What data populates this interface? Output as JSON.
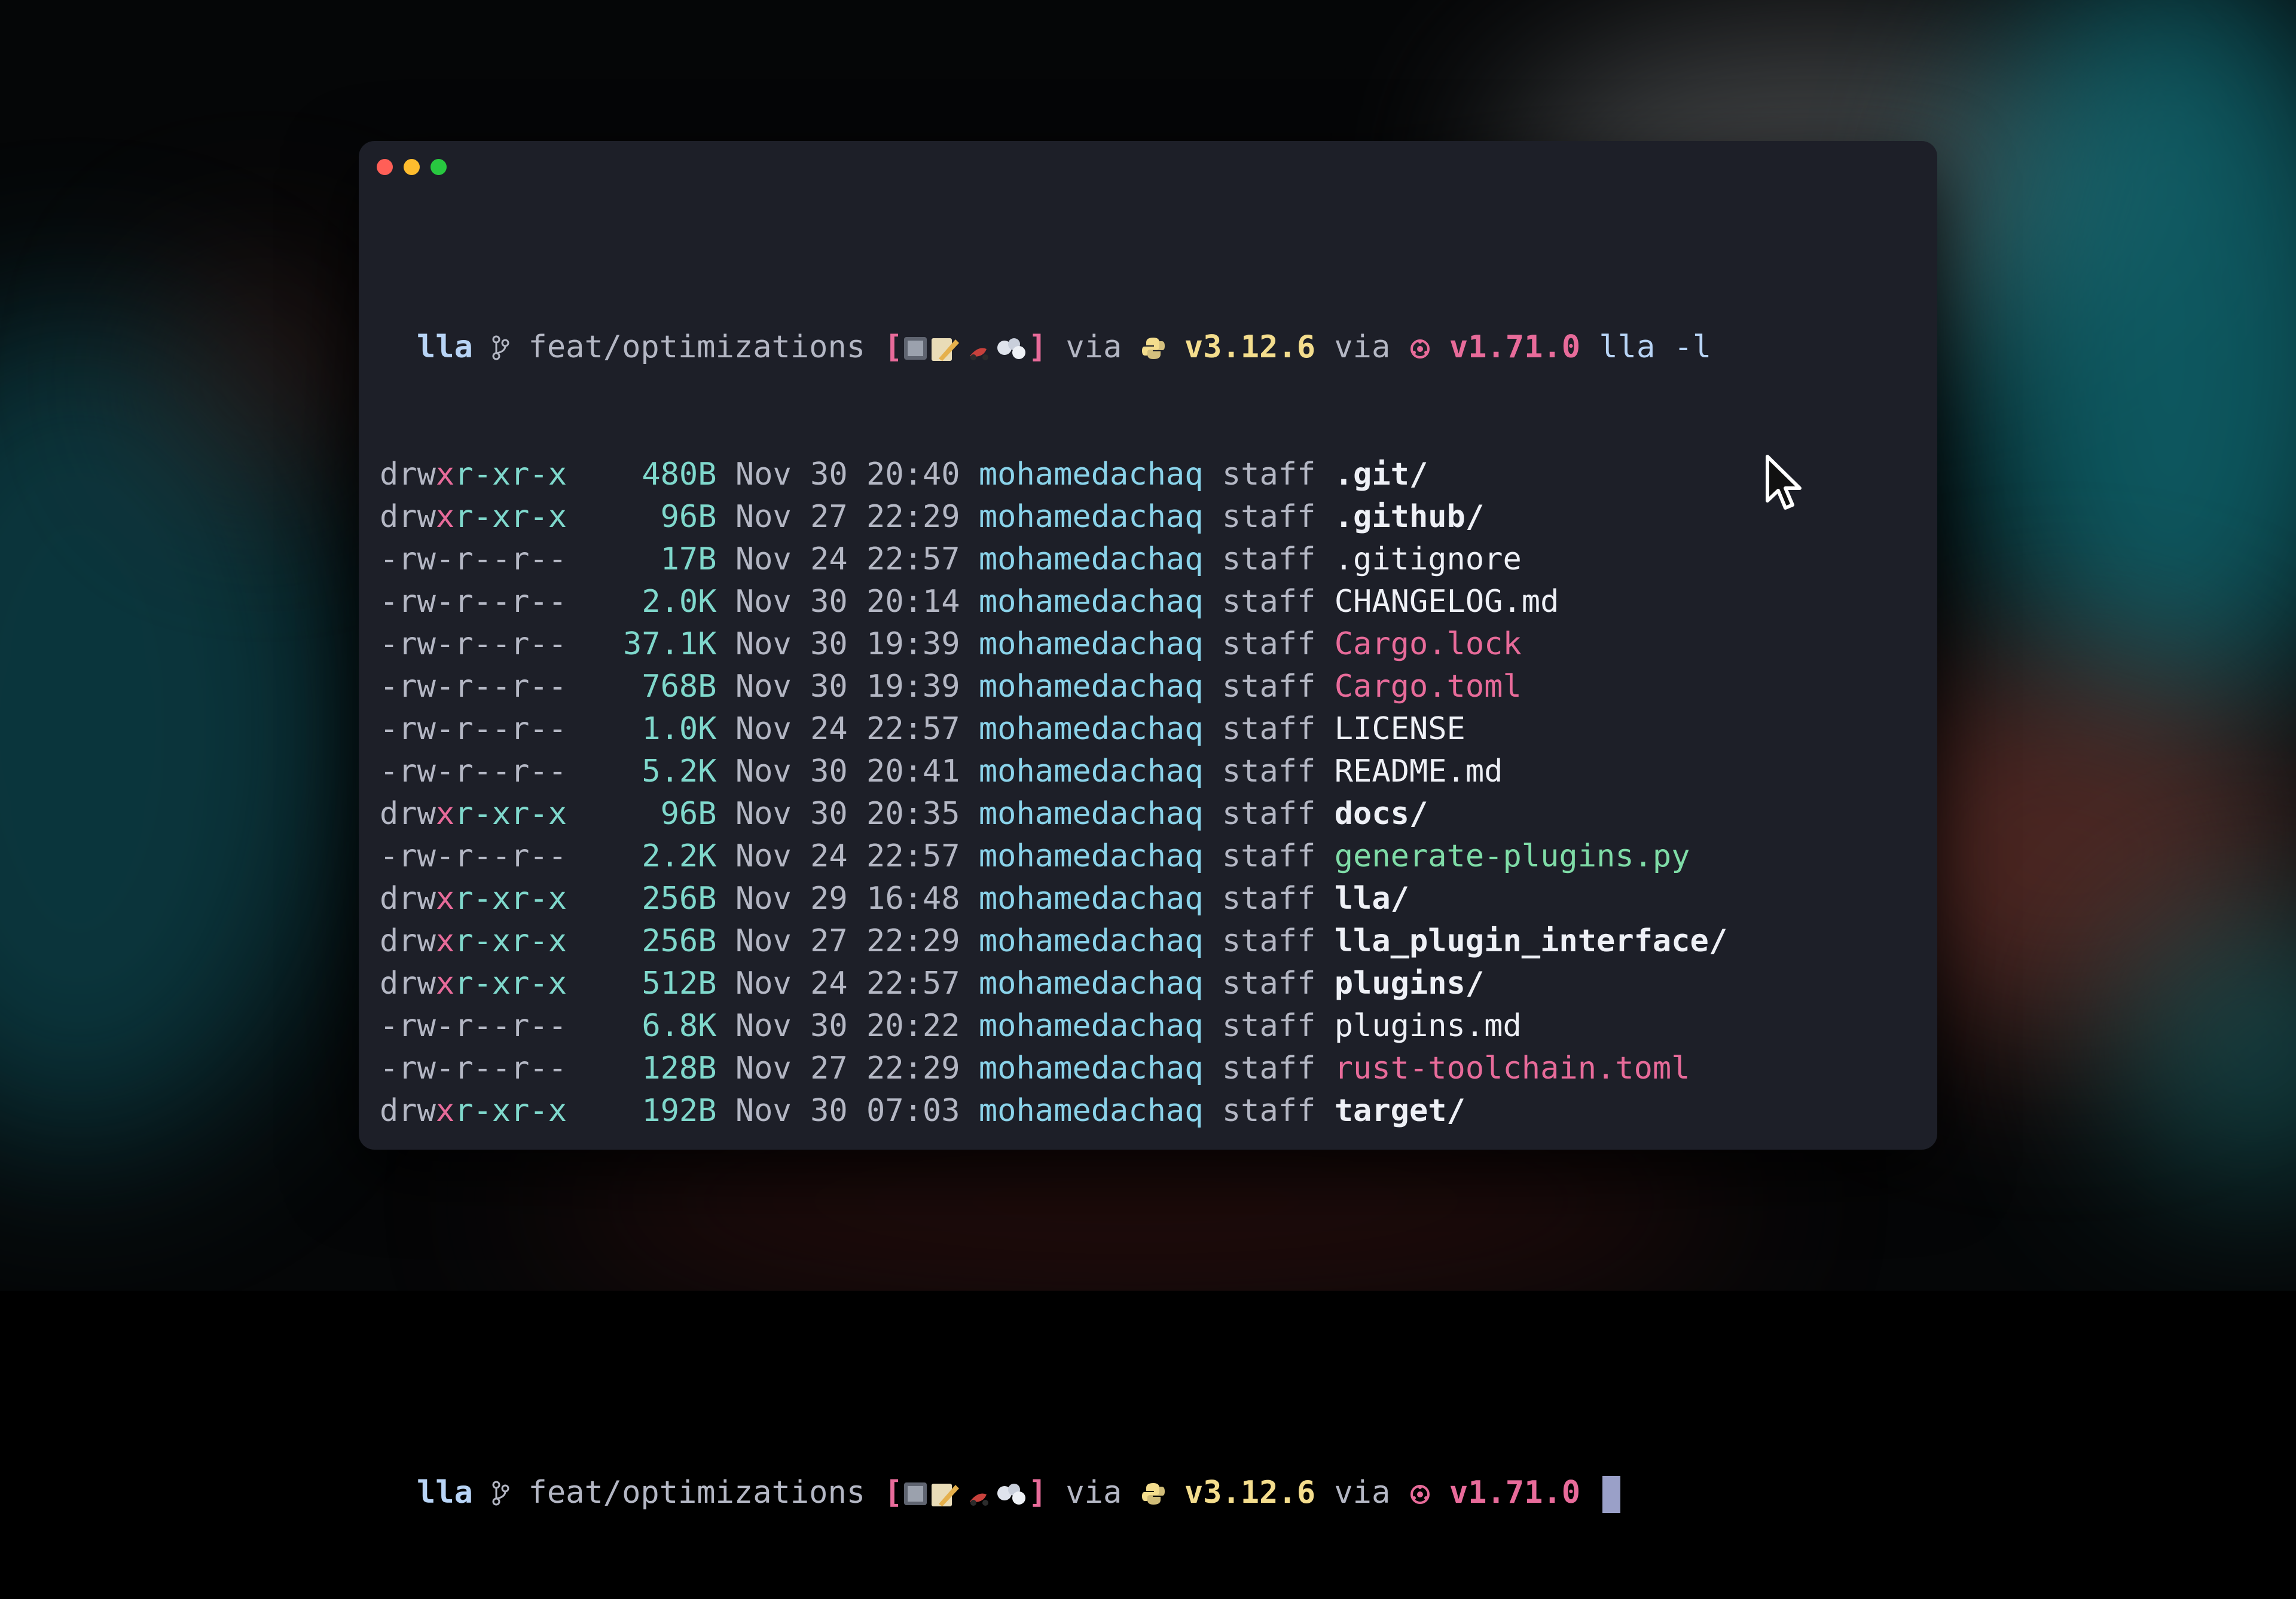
{
  "prompt": {
    "dir": "lla",
    "branch_icon": "git-branch-icon",
    "branch": "feat/optimizations",
    "status_open": "[",
    "status_close": "]",
    "via1": "via",
    "python_icon": "python-icon",
    "python_version": "v3.12.6",
    "via2": "via",
    "rust_icon": "rust-icon",
    "rust_version": "v1.71.0"
  },
  "command": "lla -l",
  "listing": [
    {
      "perm_pre": "drw",
      "perm_x": "x",
      "perm_rest": "r-xr-x",
      "size": "480B",
      "date": "Nov 30 20:40",
      "user": "mohamedachaq",
      "group": "staff",
      "name": ".git/",
      "kind": "dir"
    },
    {
      "perm_pre": "drw",
      "perm_x": "x",
      "perm_rest": "r-xr-x",
      "size": "96B",
      "date": "Nov 27 22:29",
      "user": "mohamedachaq",
      "group": "staff",
      "name": ".github/",
      "kind": "dir"
    },
    {
      "perm_pre": "-rw",
      "perm_x": "-",
      "perm_rest": "r--r--",
      "size": "17B",
      "date": "Nov 24 22:57",
      "user": "mohamedachaq",
      "group": "staff",
      "name": ".gitignore",
      "kind": "file"
    },
    {
      "perm_pre": "-rw",
      "perm_x": "-",
      "perm_rest": "r--r--",
      "size": "2.0K",
      "date": "Nov 30 20:14",
      "user": "mohamedachaq",
      "group": "staff",
      "name": "CHANGELOG.md",
      "kind": "file"
    },
    {
      "perm_pre": "-rw",
      "perm_x": "-",
      "perm_rest": "r--r--",
      "size": "37.1K",
      "date": "Nov 30 19:39",
      "user": "mohamedachaq",
      "group": "staff",
      "name": "Cargo.lock",
      "kind": "config"
    },
    {
      "perm_pre": "-rw",
      "perm_x": "-",
      "perm_rest": "r--r--",
      "size": "768B",
      "date": "Nov 30 19:39",
      "user": "mohamedachaq",
      "group": "staff",
      "name": "Cargo.toml",
      "kind": "config"
    },
    {
      "perm_pre": "-rw",
      "perm_x": "-",
      "perm_rest": "r--r--",
      "size": "1.0K",
      "date": "Nov 24 22:57",
      "user": "mohamedachaq",
      "group": "staff",
      "name": "LICENSE",
      "kind": "file"
    },
    {
      "perm_pre": "-rw",
      "perm_x": "-",
      "perm_rest": "r--r--",
      "size": "5.2K",
      "date": "Nov 30 20:41",
      "user": "mohamedachaq",
      "group": "staff",
      "name": "README.md",
      "kind": "file"
    },
    {
      "perm_pre": "drw",
      "perm_x": "x",
      "perm_rest": "r-xr-x",
      "size": "96B",
      "date": "Nov 30 20:35",
      "user": "mohamedachaq",
      "group": "staff",
      "name": "docs/",
      "kind": "dir"
    },
    {
      "perm_pre": "-rw",
      "perm_x": "-",
      "perm_rest": "r--r--",
      "size": "2.2K",
      "date": "Nov 24 22:57",
      "user": "mohamedachaq",
      "group": "staff",
      "name": "generate-plugins.py",
      "kind": "script"
    },
    {
      "perm_pre": "drw",
      "perm_x": "x",
      "perm_rest": "r-xr-x",
      "size": "256B",
      "date": "Nov 29 16:48",
      "user": "mohamedachaq",
      "group": "staff",
      "name": "lla/",
      "kind": "dir"
    },
    {
      "perm_pre": "drw",
      "perm_x": "x",
      "perm_rest": "r-xr-x",
      "size": "256B",
      "date": "Nov 27 22:29",
      "user": "mohamedachaq",
      "group": "staff",
      "name": "lla_plugin_interface/",
      "kind": "dir"
    },
    {
      "perm_pre": "drw",
      "perm_x": "x",
      "perm_rest": "r-xr-x",
      "size": "512B",
      "date": "Nov 24 22:57",
      "user": "mohamedachaq",
      "group": "staff",
      "name": "plugins/",
      "kind": "dir"
    },
    {
      "perm_pre": "-rw",
      "perm_x": "-",
      "perm_rest": "r--r--",
      "size": "6.8K",
      "date": "Nov 30 20:22",
      "user": "mohamedachaq",
      "group": "staff",
      "name": "plugins.md",
      "kind": "file"
    },
    {
      "perm_pre": "-rw",
      "perm_x": "-",
      "perm_rest": "r--r--",
      "size": "128B",
      "date": "Nov 27 22:29",
      "user": "mohamedachaq",
      "group": "staff",
      "name": "rust-toolchain.toml",
      "kind": "config"
    },
    {
      "perm_pre": "drw",
      "perm_x": "x",
      "perm_rest": "r-xr-x",
      "size": "192B",
      "date": "Nov 30 07:03",
      "user": "mohamedachaq",
      "group": "staff",
      "name": "target/",
      "kind": "dir"
    }
  ],
  "colors": {
    "window_bg": "#1d1f28",
    "dir": "#eef0f6",
    "config": "#e86b9a",
    "script": "#7fdca7",
    "size": "#7fd8cc",
    "user": "#8ad3ea",
    "exec": "#e86b9a",
    "python": "#f4dd8d",
    "rust": "#e86b9a"
  }
}
